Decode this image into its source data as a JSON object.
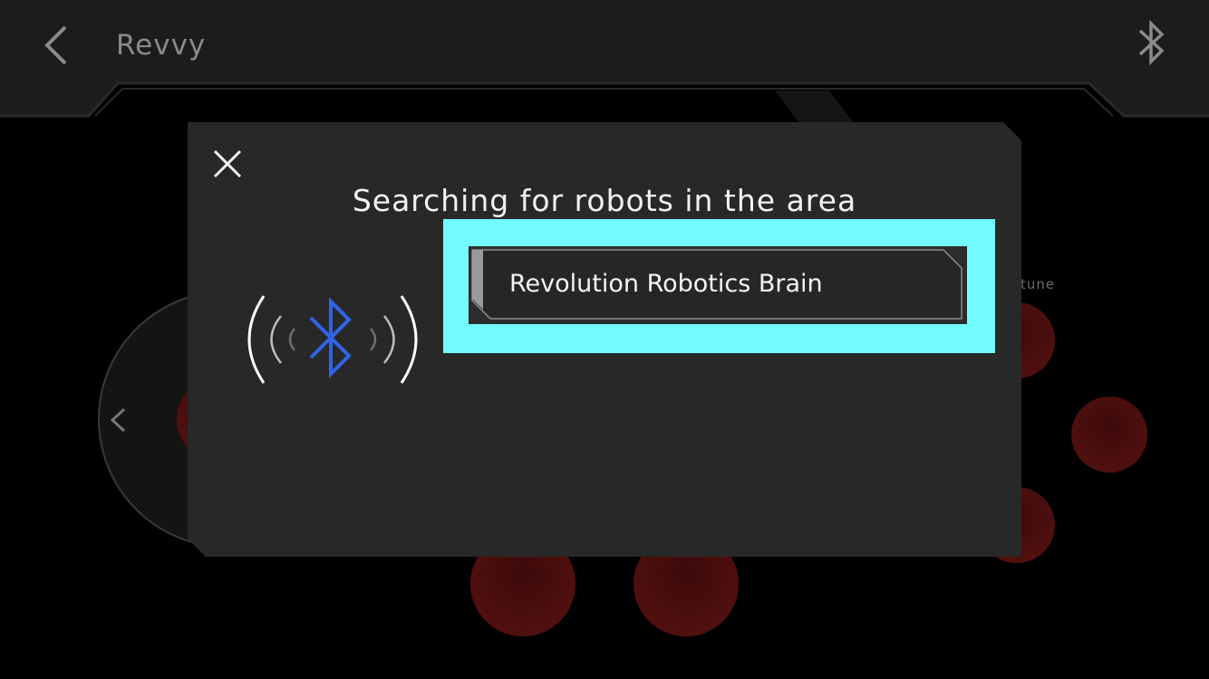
{
  "app": {
    "title": "Revvy"
  },
  "header": {
    "back_icon": "chevron-left-icon",
    "bluetooth_icon": "bluetooth-icon"
  },
  "background": {
    "side_label": "tune",
    "nav_icon": "chevron-left-icon",
    "button_color": "#4a0d0d"
  },
  "dialog": {
    "close_icon": "close-icon",
    "title": "Searching for robots in the area",
    "search_icon": "bluetooth-searching-icon",
    "robots": [
      {
        "name": "Revolution Robotics Brain"
      }
    ],
    "highlight_color": "#72fbfe",
    "bluetooth_color": "#2f63e8"
  }
}
